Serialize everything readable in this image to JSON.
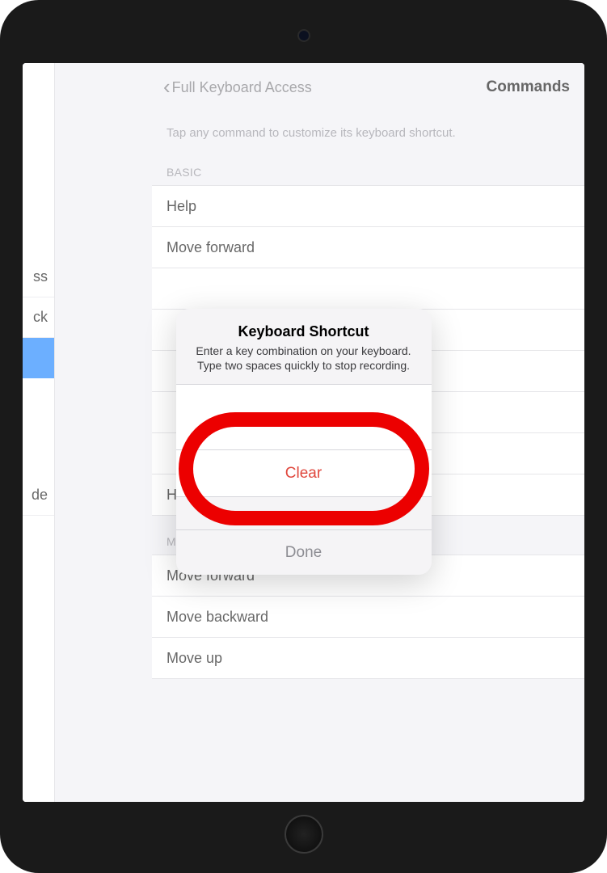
{
  "nav": {
    "back_label": "Full Keyboard Access",
    "title": "Commands"
  },
  "hint": "Tap any command to customize its keyboard shortcut.",
  "sections": {
    "basic": {
      "header": "BASIC",
      "items": [
        "Help",
        "Move forward",
        "",
        "",
        "",
        "",
        "",
        "Home"
      ]
    },
    "movement": {
      "header": "MOVEMENT",
      "items": [
        "Move forward",
        "Move backward",
        "Move up"
      ]
    }
  },
  "sidebar": {
    "i0": "ss",
    "i1": "ck",
    "i2": "",
    "i3": "de"
  },
  "modal": {
    "title": "Keyboard Shortcut",
    "subtitle": "Enter a key combination on your keyboard. Type two spaces quickly to stop recording.",
    "clear": "Clear",
    "done": "Done"
  }
}
